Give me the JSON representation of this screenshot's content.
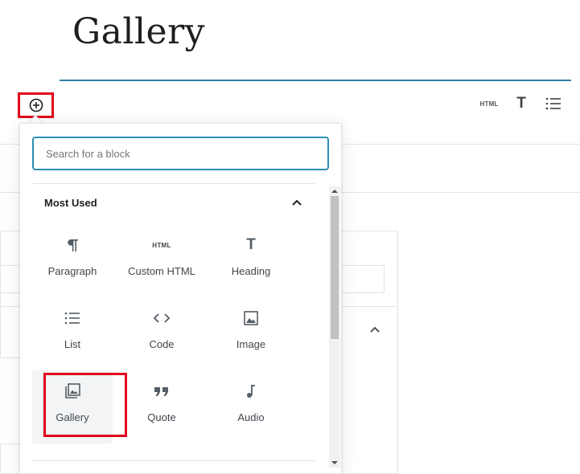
{
  "post": {
    "title": "Gallery"
  },
  "toolbar": {
    "html_label": "HTML",
    "heading_icon": "T"
  },
  "inserter": {
    "search_placeholder": "Search for a block",
    "panel_title": "Most Used",
    "blocks": [
      {
        "label": "Paragraph",
        "icon": "paragraph-icon"
      },
      {
        "label": "Custom HTML",
        "icon": "html-icon",
        "glyph": "HTML"
      },
      {
        "label": "Heading",
        "icon": "heading-icon",
        "glyph": "T"
      },
      {
        "label": "List",
        "icon": "list-icon"
      },
      {
        "label": "Code",
        "icon": "code-icon"
      },
      {
        "label": "Image",
        "icon": "image-icon"
      },
      {
        "label": "Gallery",
        "icon": "gallery-icon"
      },
      {
        "label": "Quote",
        "icon": "quote-icon"
      },
      {
        "label": "Audio",
        "icon": "audio-icon"
      }
    ]
  },
  "colors": {
    "accent": "#2d8fb6",
    "highlight": "#e0001b",
    "title_rule": "#2d7fa6"
  }
}
